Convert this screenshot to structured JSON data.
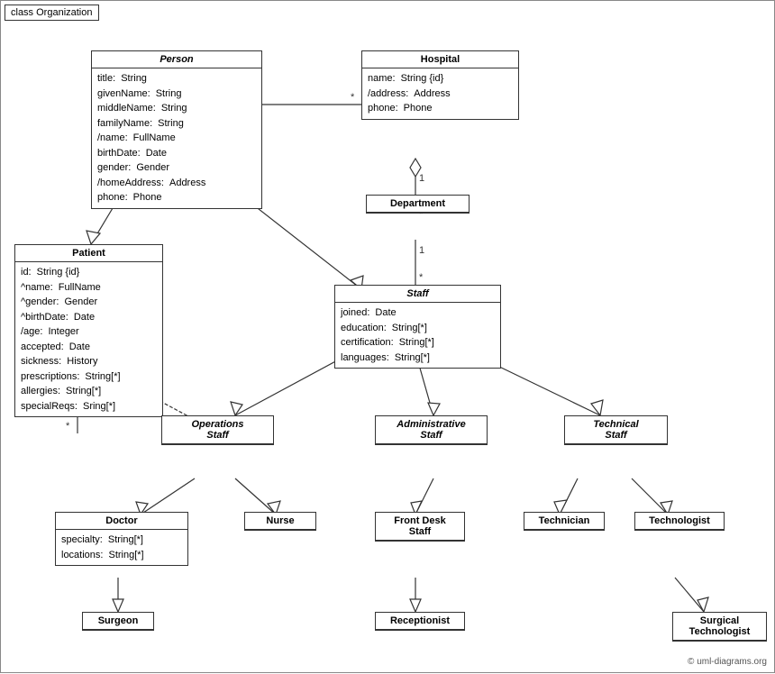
{
  "title": "class Organization",
  "copyright": "© uml-diagrams.org",
  "classes": {
    "person": {
      "name": "Person",
      "abstract": true,
      "attrs": [
        [
          "title:",
          "String"
        ],
        [
          "givenName:",
          "String"
        ],
        [
          "middleName:",
          "String"
        ],
        [
          "familyName:",
          "String"
        ],
        [
          "/name:",
          "FullName"
        ],
        [
          "birthDate:",
          "Date"
        ],
        [
          "gender:",
          "Gender"
        ],
        [
          "/homeAddress:",
          "Address"
        ],
        [
          "phone:",
          "Phone"
        ]
      ]
    },
    "hospital": {
      "name": "Hospital",
      "abstract": false,
      "attrs": [
        [
          "name:",
          "String {id}"
        ],
        [
          "/address:",
          "Address"
        ],
        [
          "phone:",
          "Phone"
        ]
      ]
    },
    "department": {
      "name": "Department",
      "abstract": false,
      "attrs": []
    },
    "staff": {
      "name": "Staff",
      "abstract": true,
      "attrs": [
        [
          "joined:",
          "Date"
        ],
        [
          "education:",
          "String[*]"
        ],
        [
          "certification:",
          "String[*]"
        ],
        [
          "languages:",
          "String[*]"
        ]
      ]
    },
    "patient": {
      "name": "Patient",
      "abstract": false,
      "attrs": [
        [
          "id:",
          "String {id}"
        ],
        [
          "^name:",
          "FullName"
        ],
        [
          "^gender:",
          "Gender"
        ],
        [
          "^birthDate:",
          "Date"
        ],
        [
          "/age:",
          "Integer"
        ],
        [
          "accepted:",
          "Date"
        ],
        [
          "sickness:",
          "History"
        ],
        [
          "prescriptions:",
          "String[*]"
        ],
        [
          "allergies:",
          "String[*]"
        ],
        [
          "specialReqs:",
          "Sring[*]"
        ]
      ]
    },
    "ops_staff": {
      "name": "Operations Staff",
      "abstract": true
    },
    "admin_staff": {
      "name": "Administrative Staff",
      "abstract": true
    },
    "tech_staff": {
      "name": "Technical Staff",
      "abstract": true
    },
    "doctor": {
      "name": "Doctor",
      "abstract": false,
      "attrs": [
        [
          "specialty:",
          "String[*]"
        ],
        [
          "locations:",
          "String[*]"
        ]
      ]
    },
    "nurse": {
      "name": "Nurse",
      "abstract": false,
      "attrs": []
    },
    "front_desk": {
      "name": "Front Desk Staff",
      "abstract": false,
      "attrs": []
    },
    "technician": {
      "name": "Technician",
      "abstract": false,
      "attrs": []
    },
    "technologist": {
      "name": "Technologist",
      "abstract": false,
      "attrs": []
    },
    "surgeon": {
      "name": "Surgeon",
      "abstract": false,
      "attrs": []
    },
    "receptionist": {
      "name": "Receptionist",
      "abstract": false,
      "attrs": []
    },
    "surgical_tech": {
      "name": "Surgical Technologist",
      "abstract": false,
      "attrs": []
    }
  }
}
